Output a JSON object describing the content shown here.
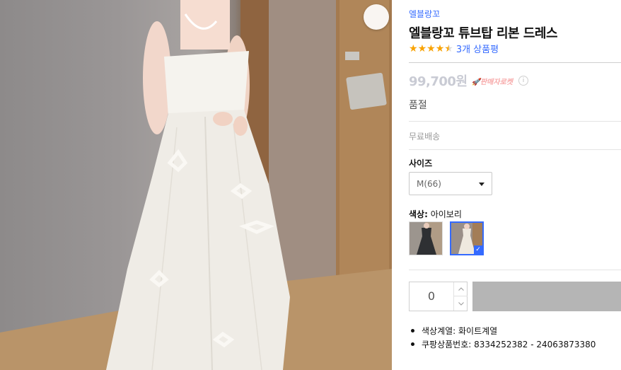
{
  "product": {
    "brand": "엘블랑꼬",
    "title": "엘블랑꼬 튜브탑 리본 드레스",
    "rating": 4.5,
    "review_link": "3개 상품평",
    "price": "99,700원",
    "rocket_badge": "판매자로켓",
    "info_symbol": "i",
    "stock_status": "품절",
    "delivery": "무료배송"
  },
  "options": {
    "size_label": "사이즈",
    "size_selected": "M(66)",
    "color_label": "색상:",
    "color_selected": "아이보리",
    "swatches": [
      {
        "name": "black",
        "selected": false,
        "color": "#2e3033"
      },
      {
        "name": "ivory",
        "selected": true,
        "color": "#efe9df"
      }
    ],
    "check_mark": "✓"
  },
  "purchase": {
    "quantity": "0",
    "up_arrow": "︿",
    "down_arrow": "﹀"
  },
  "details": [
    {
      "text": "색상계열: 화이트계열"
    },
    {
      "text": "쿠팡상품번호: 8334252382 - 24063873380"
    }
  ],
  "colors": {
    "link_blue": "#346aff",
    "star": "#f9a200",
    "price_disabled": "#c9cbd4",
    "cart_disabled": "#b5b5b5"
  },
  "icons": {
    "zoom": "zoom-search-icon",
    "caret": "caret-down-icon",
    "check": "check-icon"
  }
}
